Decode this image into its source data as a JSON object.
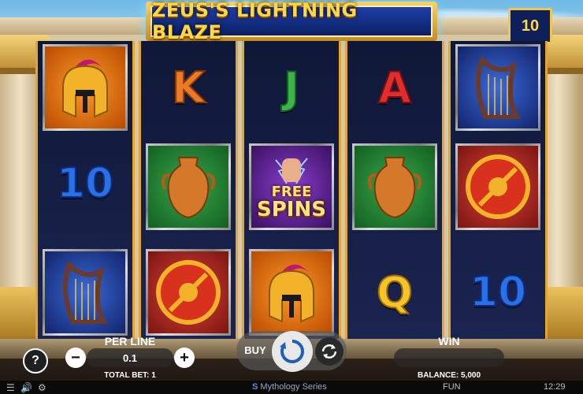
{
  "game": {
    "title": "ZEUS'S LIGHTNING BLAZE",
    "lines": "10"
  },
  "reels": [
    [
      "helmet",
      "10",
      "harp"
    ],
    [
      "K",
      "vase",
      "shield"
    ],
    [
      "J",
      "free_spins",
      "helmet"
    ],
    [
      "A",
      "vase",
      "Q"
    ],
    [
      "harp",
      "shield",
      "10"
    ]
  ],
  "symbols": {
    "ten": "10",
    "k": "K",
    "j": "J",
    "a": "A",
    "q": "Q",
    "free_spins_line1": "FREE",
    "free_spins_line2": "SPINS"
  },
  "controls": {
    "help": "?",
    "per_line_label": "PER LINE",
    "per_line_value": "0.1",
    "minus": "−",
    "plus": "+",
    "total_bet": "TOTAL BET: 1",
    "buy": "BUY",
    "win_label": "WIN",
    "win_value": "",
    "balance": "BALANCE: 5,000"
  },
  "footer": {
    "brand_prefix": "S",
    "brand": "Mythology Series",
    "mode": "FUN",
    "time": "12:29"
  },
  "colors": {
    "accent_gold": "#f0c64e",
    "reel_frame": "#e2a638",
    "title_bg": "#1d3fa8"
  }
}
